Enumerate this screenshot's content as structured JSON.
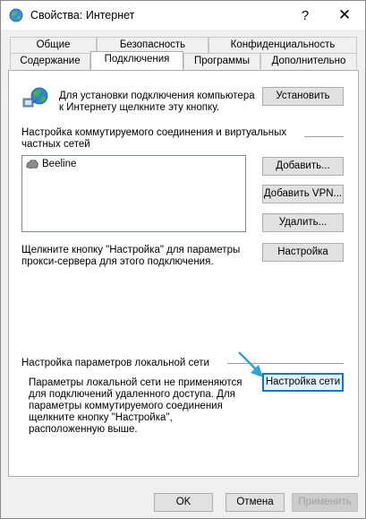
{
  "window": {
    "title": "Свойства: Интернет",
    "help_glyph": "?",
    "close_glyph": "✕"
  },
  "tabs": {
    "row1": [
      "Общие",
      "Безопасность",
      "Конфиденциальность"
    ],
    "row2": [
      "Содержание",
      "Подключения",
      "Программы",
      "Дополнительно"
    ],
    "active": "Подключения"
  },
  "setup": {
    "text": "Для установки подключения компьютера к Интернету щелкните эту кнопку.",
    "button": "Установить"
  },
  "dialup": {
    "heading": "Настройка коммутируемого соединения и виртуальных частных сетей",
    "connections": [
      "Beeline"
    ],
    "add_button": "Добавить...",
    "add_vpn_button": "Добавить VPN...",
    "remove_button": "Удалить...",
    "proxy_text": "Щелкните кнопку \"Настройка\" для параметры прокси-сервера для этого подключения.",
    "settings_button": "Настройка"
  },
  "lan": {
    "heading": "Настройка параметров локальной сети",
    "text": "Параметры локальной сети не применяются для подключений удаленного доступа. Для параметры коммутируемого соединения щелкните кнопку \"Настройка\", расположенную выше.",
    "button": "Настройка сети"
  },
  "footer": {
    "ok": "OK",
    "cancel": "Отмена",
    "apply": "Применить"
  },
  "colors": {
    "focus": "#0078d7",
    "arrow": "#29a3d9"
  }
}
